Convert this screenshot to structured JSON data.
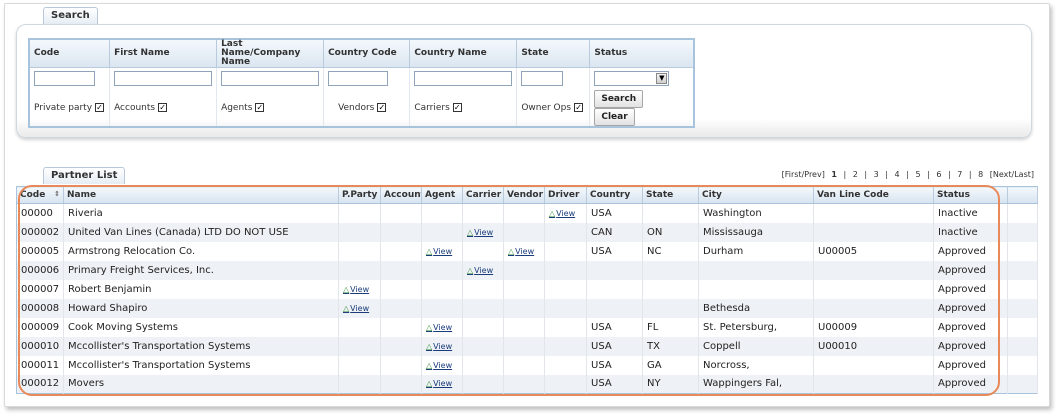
{
  "search": {
    "tab_label": "Search",
    "headers": [
      "Code",
      "First Name",
      "Last Name/Company Name",
      "Country Code",
      "Country Name",
      "State",
      "Status"
    ],
    "fields": {
      "code": "",
      "first_name": "",
      "last_name": "",
      "country_code": "",
      "country_name": "",
      "state": "",
      "status": ""
    },
    "filters": [
      {
        "label": "Private party",
        "checked": true
      },
      {
        "label": "Accounts",
        "checked": true
      },
      {
        "label": "Agents",
        "checked": true
      },
      {
        "label": "Vendors",
        "checked": true
      },
      {
        "label": "Carriers",
        "checked": true
      },
      {
        "label": "Owner Ops",
        "checked": true
      }
    ],
    "check_glyph": "✓",
    "search_button": "Search",
    "clear_button": "Clear"
  },
  "partners": {
    "tab_label": "Partner List",
    "pager": {
      "first_prev": "[First/Prev]",
      "pages": [
        "1",
        "2",
        "3",
        "4",
        "5",
        "6",
        "7",
        "8"
      ],
      "current": "1",
      "separator": "|",
      "next_last": "[Next/Last]"
    },
    "columns": [
      "Code",
      "Name",
      "P.Party",
      "Account",
      "Agent",
      "Carrier",
      "Vendor",
      "Driver",
      "Country",
      "State",
      "City",
      "Van Line Code",
      "Status"
    ],
    "view_label": "View",
    "rows": [
      {
        "code": "00000",
        "name": "Riveria",
        "pparty": "",
        "account": "",
        "agent": "",
        "carrier": "",
        "vendor": "",
        "driver": "View",
        "country": "USA",
        "state": "",
        "city": "Washington",
        "vanline": "",
        "status": "Inactive"
      },
      {
        "code": "000002",
        "name": "United Van Lines (Canada) LTD DO NOT USE",
        "pparty": "",
        "account": "",
        "agent": "",
        "carrier": "View",
        "vendor": "",
        "driver": "",
        "country": "CAN",
        "state": "ON",
        "city": "Mississauga",
        "vanline": "",
        "status": "Inactive"
      },
      {
        "code": "000005",
        "name": "Armstrong Relocation Co.",
        "pparty": "",
        "account": "",
        "agent": "View",
        "carrier": "",
        "vendor": "View",
        "driver": "",
        "country": "USA",
        "state": "NC",
        "city": "Durham",
        "vanline": "U00005",
        "status": "Approved"
      },
      {
        "code": "000006",
        "name": "Primary Freight Services, Inc.",
        "pparty": "",
        "account": "",
        "agent": "",
        "carrier": "View",
        "vendor": "",
        "driver": "",
        "country": "",
        "state": "",
        "city": "",
        "vanline": "",
        "status": "Approved"
      },
      {
        "code": "000007",
        "name": "Robert Benjamin",
        "pparty": "View",
        "account": "",
        "agent": "",
        "carrier": "",
        "vendor": "",
        "driver": "",
        "country": "",
        "state": "",
        "city": "",
        "vanline": "",
        "status": "Approved"
      },
      {
        "code": "000008",
        "name": "Howard Shapiro",
        "pparty": "View",
        "account": "",
        "agent": "",
        "carrier": "",
        "vendor": "",
        "driver": "",
        "country": "",
        "state": "",
        "city": "Bethesda",
        "vanline": "",
        "status": "Approved"
      },
      {
        "code": "000009",
        "name": "Cook Moving Systems",
        "pparty": "",
        "account": "",
        "agent": "View",
        "carrier": "",
        "vendor": "",
        "driver": "",
        "country": "USA",
        "state": "FL",
        "city": "St. Petersburg,",
        "vanline": "U00009",
        "status": "Approved"
      },
      {
        "code": "000010",
        "name": "Mccollister's Transportation Systems",
        "pparty": "",
        "account": "",
        "agent": "View",
        "carrier": "",
        "vendor": "",
        "driver": "",
        "country": "USA",
        "state": "TX",
        "city": "Coppell",
        "vanline": "U00010",
        "status": "Approved"
      },
      {
        "code": "000011",
        "name": "Mccollister's Transportation Systems",
        "pparty": "",
        "account": "",
        "agent": "View",
        "carrier": "",
        "vendor": "",
        "driver": "",
        "country": "USA",
        "state": "GA",
        "city": "Norcross,",
        "vanline": "",
        "status": "Approved"
      },
      {
        "code": "000012",
        "name": "Movers",
        "pparty": "",
        "account": "",
        "agent": "View",
        "carrier": "",
        "vendor": "",
        "driver": "",
        "country": "USA",
        "state": "NY",
        "city": "Wappingers Fal,",
        "vanline": "",
        "status": "Approved"
      }
    ]
  },
  "colors": {
    "header_border": "#a8c4dd",
    "highlight": "#e8895a",
    "link": "#1a3c7a",
    "view_icon": "#2e8b2e"
  },
  "icons": {
    "view": "triangle-outline-icon",
    "sort": "sort-arrows-icon",
    "dropdown": "chevron-down-icon",
    "checkbox": "checkmark-icon"
  }
}
